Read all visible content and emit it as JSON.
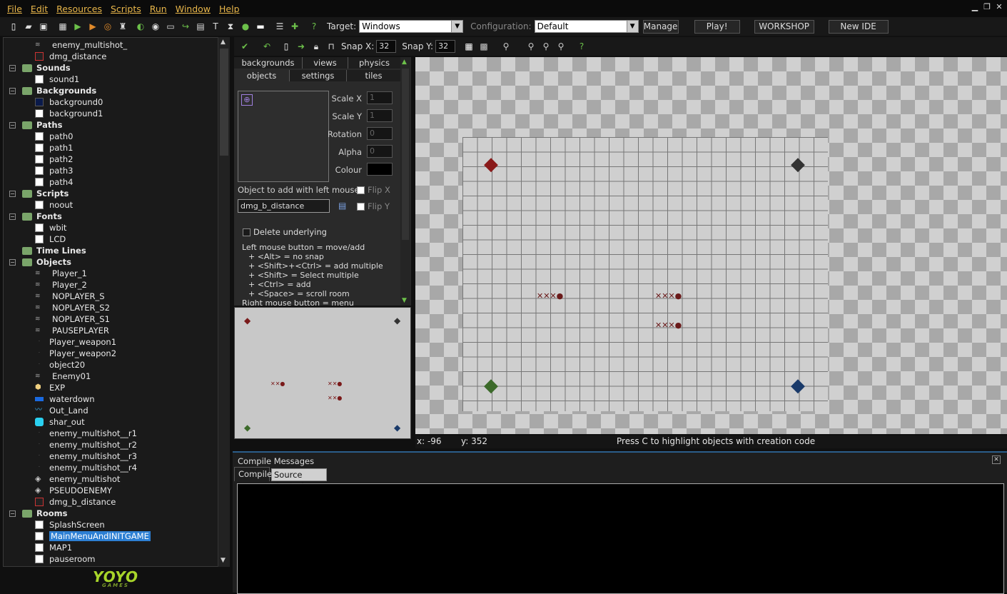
{
  "menu": [
    "File",
    "Edit",
    "Resources",
    "Scripts",
    "Run",
    "Window",
    "Help"
  ],
  "toolbar": {
    "target_label": "Target:",
    "target_value": "Windows",
    "config_label": "Configuration:",
    "config_value": "Default",
    "manage": "Manage",
    "play": "Play!",
    "workshop": "WORKSHOP",
    "new_ide": "New IDE"
  },
  "tree": {
    "top_items": [
      "enemy_multishot_",
      "dmg_distance"
    ],
    "sounds": {
      "label": "Sounds",
      "items": [
        "sound1"
      ]
    },
    "backgrounds": {
      "label": "Backgrounds",
      "items": [
        "background0",
        "background1"
      ]
    },
    "paths": {
      "label": "Paths",
      "items": [
        "path0",
        "path1",
        "path2",
        "path3",
        "path4"
      ]
    },
    "scripts": {
      "label": "Scripts",
      "items": [
        "noout"
      ]
    },
    "fonts": {
      "label": "Fonts",
      "items": [
        "wbit",
        "LCD"
      ]
    },
    "timelines": {
      "label": "Time Lines"
    },
    "objects": {
      "label": "Objects",
      "items": [
        "Player_1",
        "Player_2",
        "NOPLAYER_S",
        "NOPLAYER_S2",
        "NOPLAYER_S1",
        "PAUSEPLAYER",
        "Player_weapon1",
        "Player_weapon2",
        "object20",
        "Enemy01",
        "EXP",
        "waterdown",
        "Out_Land",
        "shar_out",
        "enemy_multishot__r1",
        "enemy_multishot__r2",
        "enemy_multishot__r3",
        "enemy_multishot__r4",
        "enemy_multishot",
        "PSEUDOENEMY",
        "dmg_b_distance"
      ]
    },
    "rooms": {
      "label": "Rooms",
      "items": [
        "SplashScreen",
        "MainMenuAndINITGAME",
        "MAP1",
        "pauseroom"
      ]
    }
  },
  "logo": {
    "text": "YOYO",
    "sub": "GAMES"
  },
  "room_toolbar": {
    "snapx_label": "Snap X:",
    "snapx": "32",
    "snapy_label": "Snap Y:",
    "snapy": "32"
  },
  "props": {
    "tabs_row1": [
      "backgrounds",
      "views",
      "physics"
    ],
    "tabs_row2": [
      "objects",
      "settings",
      "tiles"
    ],
    "scale_x_label": "Scale X",
    "scale_x": "1",
    "scale_y_label": "Scale Y",
    "scale_y": "1",
    "rotation_label": "Rotation",
    "rotation": "0",
    "alpha_label": "Alpha",
    "alpha": "0",
    "colour_label": "Colour",
    "object_label": "Object to add with left mouse:",
    "object_value": "dmg_b_distance",
    "flipx": "Flip X",
    "flipy": "Flip Y",
    "delete_underlying": "Delete underlying",
    "help": [
      "Left mouse button = move/add",
      "+ <Alt> = no snap",
      "+ <Shift>+<Ctrl> = add multiple",
      "+ <Shift> = Select multiple",
      "+ <Ctrl> = add",
      "+ <Space> = scroll room",
      "Right mouse button = menu"
    ]
  },
  "status": {
    "x": "x: -96",
    "y": "y: 352",
    "hint": "Press C to highlight objects with creation code"
  },
  "compile": {
    "title": "Compile Messages",
    "tab_compile": "Compile",
    "tab_source": "Source Control"
  }
}
